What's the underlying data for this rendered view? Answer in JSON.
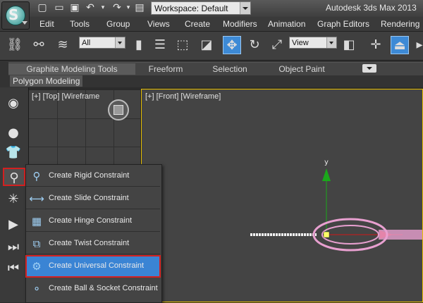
{
  "titlebar": {
    "workspace_label": "Workspace: Default",
    "app_title": "Autodesk 3ds Max  2013"
  },
  "menubar": {
    "items": [
      "Edit",
      "Tools",
      "Group",
      "Views",
      "Create",
      "Modifiers",
      "Animation",
      "Graph Editors",
      "Rendering"
    ]
  },
  "toolbar": {
    "selection_filter": "All",
    "reference_coord": "View"
  },
  "ribbon": {
    "tabs": [
      "Graphite Modeling Tools",
      "Freeform",
      "Selection",
      "Object Paint"
    ],
    "panel_label": "Polygon Modeling"
  },
  "viewports": {
    "top_label": "[+] [Top] [Wireframe",
    "front_label": "[+] [Front] [Wireframe]",
    "axis_y_label": "y"
  },
  "flyout": {
    "items": [
      "Create Rigid Constraint",
      "Create Slide Constraint",
      "Create Hinge Constraint",
      "Create Twist Constraint",
      "Create Universal Constraint",
      "Create Ball & Socket Constraint"
    ],
    "selected_index": 4
  },
  "colors": {
    "accent_selected": "#3a84d4",
    "highlight_border": "#d32020",
    "active_viewport_border": "#e8c000",
    "gizmo_y": "#1aa81a",
    "gizmo_x": "#d01818",
    "object_wireframe": "#e8a0d0"
  }
}
